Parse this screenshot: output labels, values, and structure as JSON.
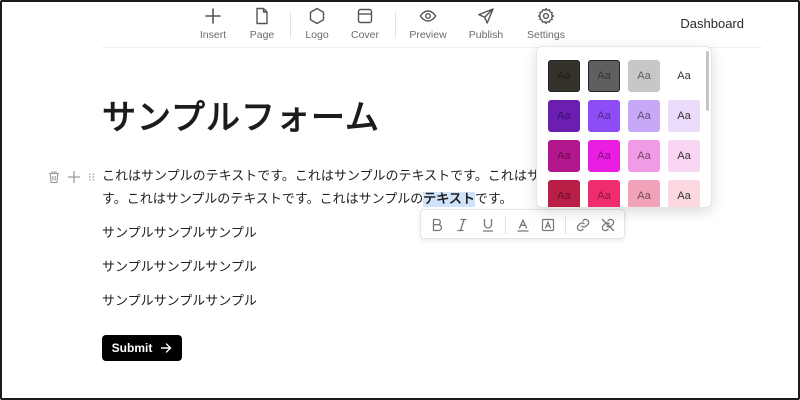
{
  "toolbar": {
    "items": [
      {
        "label": "Insert",
        "icon": "plus-icon"
      },
      {
        "label": "Page",
        "icon": "page-icon"
      },
      {
        "label": "Logo",
        "icon": "hexagon-icon"
      },
      {
        "label": "Cover",
        "icon": "cover-icon"
      },
      {
        "label": "Preview",
        "icon": "eye-icon"
      },
      {
        "label": "Publish",
        "icon": "send-icon"
      },
      {
        "label": "Settings",
        "icon": "gear-icon"
      }
    ],
    "dashboard": "Dashboard"
  },
  "form": {
    "title": "サンプルフォーム",
    "paragraph": {
      "line1": "これはサンプルのテキストです。これはサンプルのテキストです。これはサンプルのテキストで",
      "line2_before": "す。これはサンプルのテキストです。これはサンプルの",
      "line2_highlight": "テキスト",
      "line2_after": "です。"
    },
    "lines": [
      "サンプルサンプルサンプル",
      "サンプルサンプルサンプル",
      "サンプルサンプルサンプル"
    ],
    "submit_label": "Submit"
  },
  "format_toolbar": {
    "buttons": [
      "bold-icon",
      "italic-icon",
      "underline-icon",
      "text-color-icon",
      "highlight-icon",
      "link-icon",
      "unlink-icon"
    ]
  },
  "color_picker": {
    "swatch_label": "Aa",
    "rows": [
      [
        "#35322c",
        "#5f5f5f",
        "#c7c7c7",
        "#ffffff"
      ],
      [
        "#6a1fb0",
        "#8e4cf6",
        "#c7a8f6",
        "#ebdcfb"
      ],
      [
        "#b2178d",
        "#e91ee2",
        "#f19ae6",
        "#f9d6f4"
      ],
      [
        "#b81e46",
        "#ef2c6d",
        "#f1a2b8",
        "#fbd8e0"
      ]
    ]
  }
}
